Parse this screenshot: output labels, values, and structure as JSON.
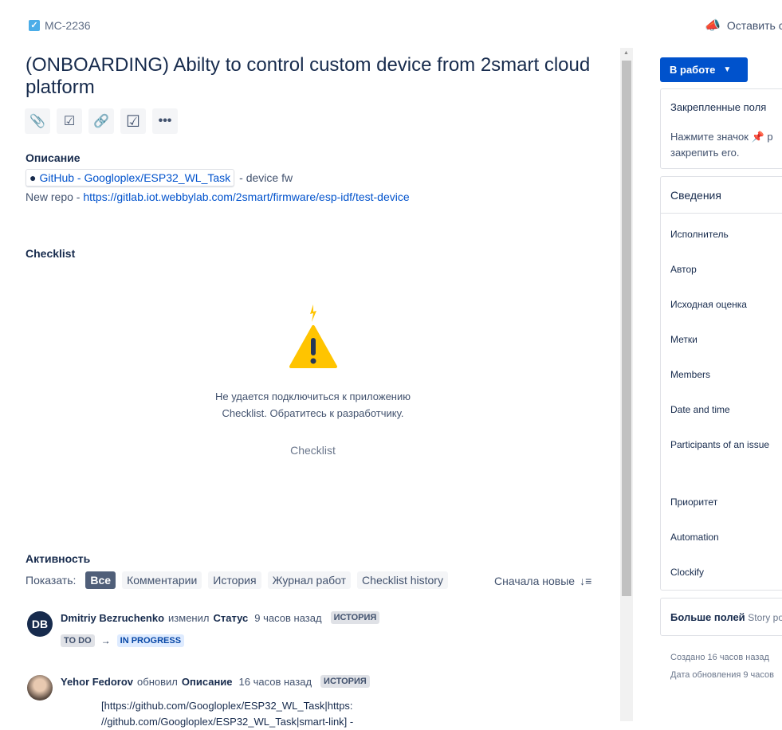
{
  "issue": {
    "key": "MC-2236",
    "title": "(ONBOARDING) Abilty to control custom device from 2smart cloud platform"
  },
  "header": {
    "feedback_label": "Оставить с"
  },
  "toolbar": {
    "icons": [
      "attachment-icon",
      "subtask-icon",
      "link-icon",
      "checklist-icon",
      "more-icon"
    ]
  },
  "description": {
    "label": "Описание",
    "smart_link": "GitHub - Googloplex/ESP32_WL_Task",
    "smart_link_suffix": "- device fw",
    "repo_prefix": "New repo - ",
    "repo_url": "https://gitlab.iot.webbylab.com/2smart/firmware/esp-idf/test-device"
  },
  "checklist": {
    "label": "Checklist",
    "error_line1": "Не удается подключиться к приложению",
    "error_line2": "Checklist. Обратитесь к разработчику.",
    "app_name": "Checklist"
  },
  "activity": {
    "label": "Активность",
    "show_label": "Показать:",
    "filters": [
      "Все",
      "Комментарии",
      "История",
      "Журнал работ",
      "Checklist history"
    ],
    "active_filter": "Все",
    "sort_label": "Сначала новые",
    "entries": [
      {
        "initials": "DB",
        "author": "Dmitriy Bezruchenko",
        "action": "изменил",
        "field": "Статус",
        "time": "9 часов назад",
        "tag": "ИСТОРИЯ",
        "from": "TO DO",
        "arrow": "→",
        "to": "IN PROGRESS"
      },
      {
        "author": "Yehor Fedorov",
        "action": "обновил",
        "field": "Описание",
        "time": "16 часов назад",
        "tag": "ИСТОРИЯ",
        "text1": "[https://github.com/Googloplex/ESP32_WL_Task|https:",
        "text2": "//github.com/Googloplex/ESP32_WL_Task|smart-link] -"
      }
    ]
  },
  "sidebar": {
    "status": "В работе",
    "pinned_title": "Закрепленные поля",
    "pinned_hint1": "Нажмите значок",
    "pinned_hint1_tail": "р",
    "pinned_hint2": "закрепить его.",
    "details_title": "Сведения",
    "fields": [
      "Исполнитель",
      "Автор",
      "Исходная оценка",
      "Метки",
      "Members",
      "Date and time",
      "Participants of an issue",
      "Приоритет",
      "Automation",
      "Clockify"
    ],
    "more_fields": "Больше полей",
    "more_fields_hint": "Story po",
    "created": "Создано 16 часов назад",
    "updated": "Дата обновления 9 часов"
  },
  "colors": {
    "primary": "#0052cc",
    "text": "#172b4d",
    "chip_active": "#505f79"
  }
}
